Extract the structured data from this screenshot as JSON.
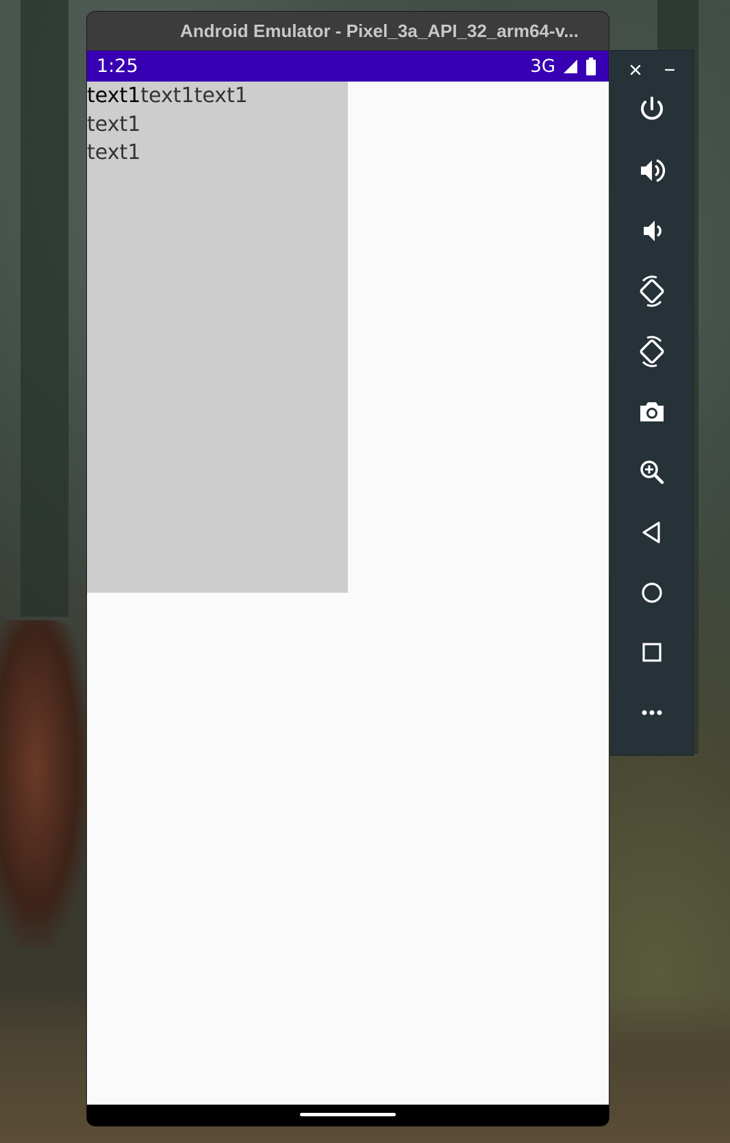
{
  "window": {
    "title": "Android Emulator - Pixel_3a_API_32_arm64-v..."
  },
  "status_bar": {
    "time": "1:25",
    "network": "3G",
    "color": "#3700b3"
  },
  "screen": {
    "rows": [
      {
        "segments": [
          "text1",
          "text1text1"
        ]
      },
      {
        "segments": [
          "text1"
        ]
      },
      {
        "segments": [
          "text1"
        ]
      }
    ],
    "panel_color": "#cdcdcd",
    "background_color": "#fafafa"
  },
  "toolbar": {
    "buttons": [
      {
        "name": "power-button",
        "icon": "power-icon"
      },
      {
        "name": "volume-up-button",
        "icon": "volume-up-icon"
      },
      {
        "name": "volume-down-button",
        "icon": "volume-down-icon"
      },
      {
        "name": "rotate-left-button",
        "icon": "rotate-left-icon"
      },
      {
        "name": "rotate-right-button",
        "icon": "rotate-right-icon"
      },
      {
        "name": "screenshot-button",
        "icon": "camera-icon"
      },
      {
        "name": "zoom-button",
        "icon": "zoom-in-icon"
      },
      {
        "name": "back-button",
        "icon": "back-triangle-icon"
      },
      {
        "name": "home-button",
        "icon": "home-circle-icon"
      },
      {
        "name": "overview-button",
        "icon": "overview-square-icon"
      },
      {
        "name": "more-button",
        "icon": "more-dots-icon"
      }
    ],
    "color": "#263238"
  }
}
